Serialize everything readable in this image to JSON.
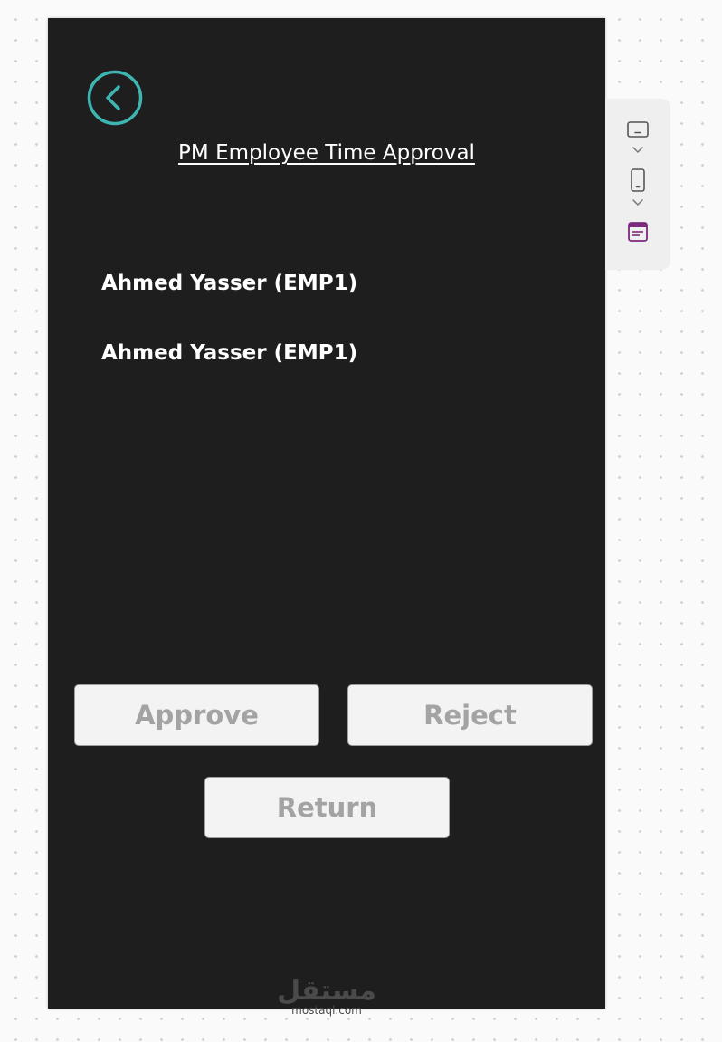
{
  "screen": {
    "title": "PM Employee Time Approval",
    "back_icon": "chevron-left-circle-icon",
    "accent_color": "#3fb5b2"
  },
  "employees": [
    {
      "label": "Ahmed Yasser (EMP1)"
    },
    {
      "label": "Ahmed Yasser (EMP1)"
    }
  ],
  "actions": {
    "approve_label": "Approve",
    "reject_label": "Reject",
    "return_label": "Return"
  },
  "watermark": {
    "logo_text": "مستقل",
    "site": "mostaql.com"
  },
  "side_toolbar": {
    "tools": [
      {
        "icon": "tablet-landscape-icon"
      },
      {
        "icon": "chevron-down-icon"
      },
      {
        "icon": "phone-portrait-icon"
      },
      {
        "icon": "chevron-down-icon"
      },
      {
        "icon": "calendar-icon",
        "color": "#7b2a7e"
      }
    ]
  }
}
